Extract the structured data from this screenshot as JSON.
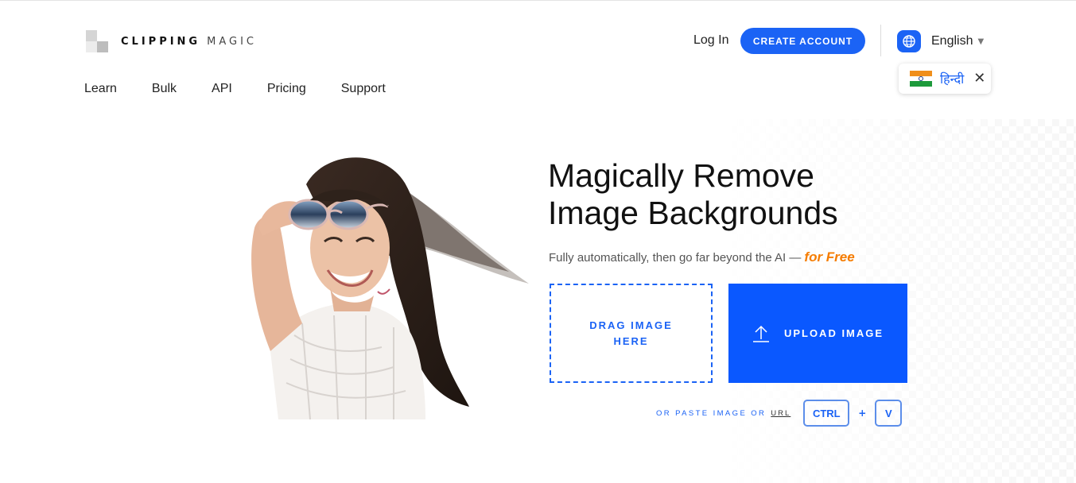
{
  "brand": {
    "name_bold": "CLIPPING",
    "name_light": "MAGIC"
  },
  "nav": {
    "items": [
      "Learn",
      "Bulk",
      "API",
      "Pricing",
      "Support"
    ]
  },
  "header": {
    "login_label": "Log In",
    "create_account_label": "CREATE ACCOUNT",
    "language_label": "English",
    "language_suggestion": "हिन्दी"
  },
  "hero": {
    "headline_line1": "Magically Remove",
    "headline_line2": "Image Backgrounds",
    "tagline": "Fully automatically, then go far beyond the AI —",
    "tagline_emphasis": "for Free",
    "drag_label": "DRAG IMAGE HERE",
    "upload_label": "UPLOAD IMAGE",
    "paste_text": "OR PASTE IMAGE OR",
    "paste_url": "URL",
    "key_ctrl": "CTRL",
    "key_plus": "+",
    "key_v": "V"
  },
  "colors": {
    "accent": "#1b63f5",
    "upload": "#0a58ff",
    "emphasis": "#f57c00"
  }
}
